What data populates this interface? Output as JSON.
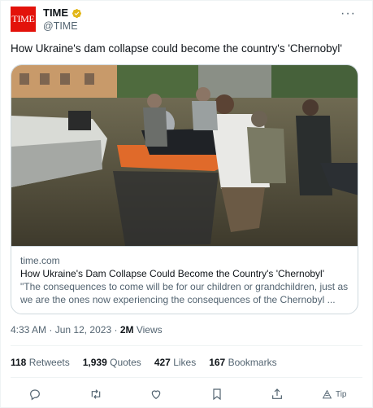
{
  "author": {
    "avatar_text": "TIME",
    "display_name": "TIME",
    "handle": "@TIME",
    "verified_icon": "gold-verified-badge",
    "avatar_color": "#e3120b"
  },
  "more_icon": "more-horizontal-icon",
  "tweet": {
    "text": "How Ukraine's dam collapse could become the country's 'Chernobyl'"
  },
  "card": {
    "domain": "time.com",
    "title": "How Ukraine's Dam Collapse Could Become the Country's 'Chernobyl'",
    "description_line1": "\"The consequences to come will be for our children or grandchildren, just as",
    "description_line2": "we are the ones now experiencing the consequences of the Chernobyl ..."
  },
  "meta": {
    "time": "4:33 AM",
    "separator": "·",
    "date": "Jun 12, 2023",
    "views_count": "2M",
    "views_label": "Views"
  },
  "stats": {
    "retweets_count": "118",
    "retweets_label": "Retweets",
    "quotes_count": "1,939",
    "quotes_label": "Quotes",
    "likes_count": "427",
    "likes_label": "Likes",
    "bookmarks_count": "167",
    "bookmarks_label": "Bookmarks"
  },
  "actions": {
    "reply_icon": "reply-icon",
    "retweet_icon": "retweet-icon",
    "like_icon": "heart-icon",
    "bookmark_icon": "bookmark-icon",
    "share_icon": "share-icon",
    "tip_label": "Tip"
  },
  "colors": {
    "text": "#0f1419",
    "secondary": "#536471",
    "border": "#cfd9de",
    "brand": "#e3120b",
    "verified_gold": "#e2b719"
  }
}
